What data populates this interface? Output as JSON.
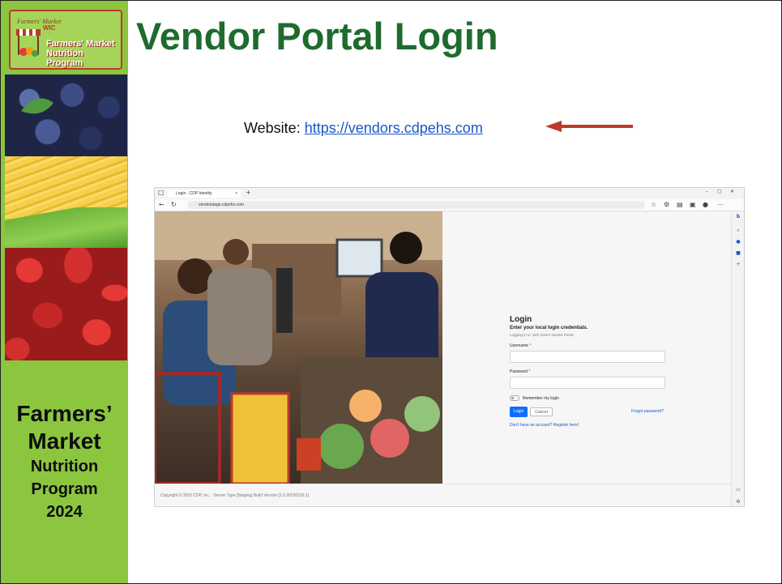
{
  "slide": {
    "title": "Vendor Portal Login",
    "website_label": "Website: ",
    "website_url": "https://vendors.cdpehs.com",
    "accent_title_color": "#1e6b2e",
    "sidebar_color": "#8cc63f",
    "arrow_color": "#c0392b"
  },
  "sidebar": {
    "logo_banner": "Farmers' Market",
    "logo_wic": "WIC",
    "logo_line1": "Farmers' Market",
    "logo_line2": "Nutrition Program",
    "title_line1": "Farmers’",
    "title_line2": "Market",
    "title_line3": "Nutrition",
    "title_line4": "Program",
    "title_line5": "2024"
  },
  "browser": {
    "tab_title": "Login - CDP Identity",
    "tab_close": "×",
    "new_tab": "+",
    "address": "vendorstage.cdpehs.com",
    "page": {
      "login_title": "Login",
      "subtitle": "Enter your local login credentials.",
      "logging_in": "Logging in to: WIC Direct Vendor Portal",
      "username_label": "Username",
      "password_label": "Password",
      "required_mark": "*",
      "remember_label": "Remember my login",
      "login_button": "Login",
      "cancel_button": "Cancel",
      "forgot_link": "Forgot password?",
      "register_link": "Don't have an account? Register here!"
    },
    "footer": "Copyright © 2023 CDP, Inc. · Server Type [Staging] Build Version [1.5.20230316.1]"
  }
}
